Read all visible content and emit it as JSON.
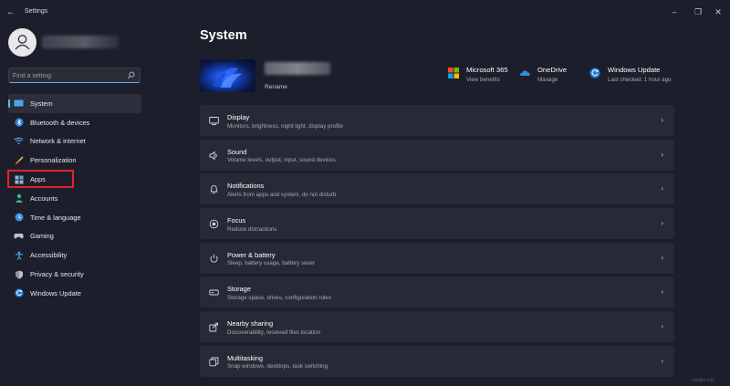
{
  "window": {
    "title": "Settings",
    "back_icon": "back-arrow-icon"
  },
  "sidebar": {
    "search_placeholder": "Find a setting",
    "items": [
      {
        "label": "System",
        "icon": "monitor-icon",
        "active": true
      },
      {
        "label": "Bluetooth & devices",
        "icon": "bluetooth-icon"
      },
      {
        "label": "Network & internet",
        "icon": "wifi-icon"
      },
      {
        "label": "Personalization",
        "icon": "brush-icon"
      },
      {
        "label": "Apps",
        "icon": "apps-icon",
        "highlighted": true
      },
      {
        "label": "Accounts",
        "icon": "person-icon"
      },
      {
        "label": "Time & language",
        "icon": "globe-clock-icon"
      },
      {
        "label": "Gaming",
        "icon": "gamepad-icon"
      },
      {
        "label": "Accessibility",
        "icon": "accessibility-icon"
      },
      {
        "label": "Privacy & security",
        "icon": "shield-icon"
      },
      {
        "label": "Windows Update",
        "icon": "update-icon"
      }
    ]
  },
  "main": {
    "title": "System",
    "device": {
      "rename_label": "Rename"
    },
    "tiles": [
      {
        "title": "Microsoft 365",
        "sub": "View benefits",
        "icon": "microsoft-365-icon"
      },
      {
        "title": "OneDrive",
        "sub": "Manage",
        "icon": "onedrive-cloud-icon"
      },
      {
        "title": "Windows Update",
        "sub": "Last checked: 1 hour ago",
        "icon": "windows-update-icon"
      }
    ],
    "cards": [
      {
        "title": "Display",
        "sub": "Monitors, brightness, night light, display profile",
        "icon": "display-icon"
      },
      {
        "title": "Sound",
        "sub": "Volume levels, output, input, sound devices",
        "icon": "speaker-icon"
      },
      {
        "title": "Notifications",
        "sub": "Alerts from apps and system, do not disturb",
        "icon": "bell-icon"
      },
      {
        "title": "Focus",
        "sub": "Reduce distractions",
        "icon": "focus-icon"
      },
      {
        "title": "Power & battery",
        "sub": "Sleep, battery usage, battery saver",
        "icon": "power-icon"
      },
      {
        "title": "Storage",
        "sub": "Storage space, drives, configuration rules",
        "icon": "storage-icon"
      },
      {
        "title": "Nearby sharing",
        "sub": "Discoverability, received files location",
        "icon": "share-icon"
      },
      {
        "title": "Multitasking",
        "sub": "Snap windows, desktops, task switching",
        "icon": "multitask-icon"
      }
    ]
  },
  "colors": {
    "background": "#1c1f2b",
    "card": "#272a36",
    "accent": "#4cc2ff",
    "highlight_box": "#e5222a"
  },
  "watermark": "wintips.org"
}
